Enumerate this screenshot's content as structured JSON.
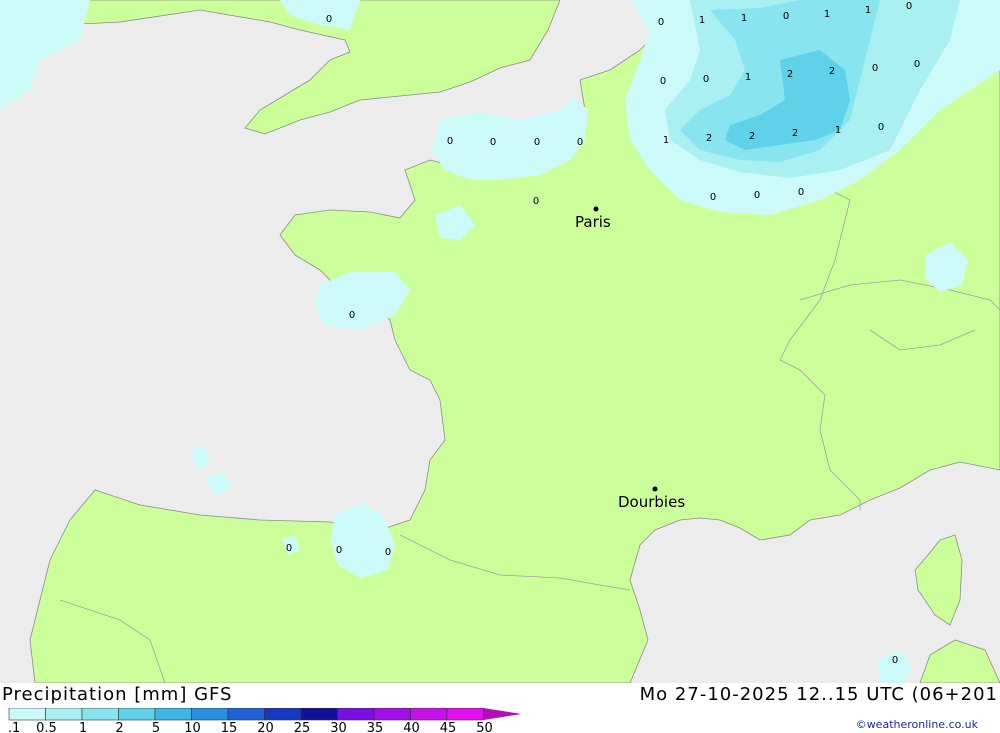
{
  "map": {
    "colors": {
      "sea": "#ececec",
      "land": "#ccff99",
      "border": "#a0a0a0",
      "precip_01": "#ccfaf8",
      "precip_05": "#aaf0f2",
      "precip_1": "#88e4ee",
      "precip_2": "#5fd2ea"
    },
    "cities": [
      {
        "name": "Paris"
      },
      {
        "name": "Dourbies"
      }
    ],
    "contour_labels": [
      {
        "value": "0"
      },
      {
        "value": "0"
      },
      {
        "value": "1"
      },
      {
        "value": "1"
      },
      {
        "value": "0"
      },
      {
        "value": "1"
      },
      {
        "value": "1"
      },
      {
        "value": "0"
      },
      {
        "value": "0"
      },
      {
        "value": "0"
      },
      {
        "value": "1"
      },
      {
        "value": "2"
      },
      {
        "value": "2"
      },
      {
        "value": "0"
      },
      {
        "value": "0"
      },
      {
        "value": "0"
      },
      {
        "value": "0"
      },
      {
        "value": "0"
      },
      {
        "value": "0"
      },
      {
        "value": "1"
      },
      {
        "value": "2"
      },
      {
        "value": "2"
      },
      {
        "value": "2"
      },
      {
        "value": "1"
      },
      {
        "value": "0"
      },
      {
        "value": "0"
      },
      {
        "value": "0"
      },
      {
        "value": "0"
      },
      {
        "value": "0"
      },
      {
        "value": "0"
      },
      {
        "value": "0"
      },
      {
        "value": "0"
      },
      {
        "value": "0"
      },
      {
        "value": "0"
      }
    ]
  },
  "footer": {
    "title": "Precipitation [mm] GFS",
    "time": "Mo 27-10-2025 12..15 UTC (06+201",
    "credit": "©weatheronline.co.uk"
  },
  "legend": {
    "ticks": [
      "0.1",
      "0.5",
      "1",
      "2",
      "5",
      "10",
      "15",
      "20",
      "25",
      "30",
      "35",
      "40",
      "45",
      "50"
    ],
    "colors": [
      "#ccfaf8",
      "#aaf0f2",
      "#88e4ee",
      "#5fd2ea",
      "#3fb4e6",
      "#2a8fe0",
      "#2060d8",
      "#1838c0",
      "#10109a",
      "#7a10e0",
      "#a010e6",
      "#c810e8",
      "#e010f0",
      "#b010b0"
    ]
  }
}
